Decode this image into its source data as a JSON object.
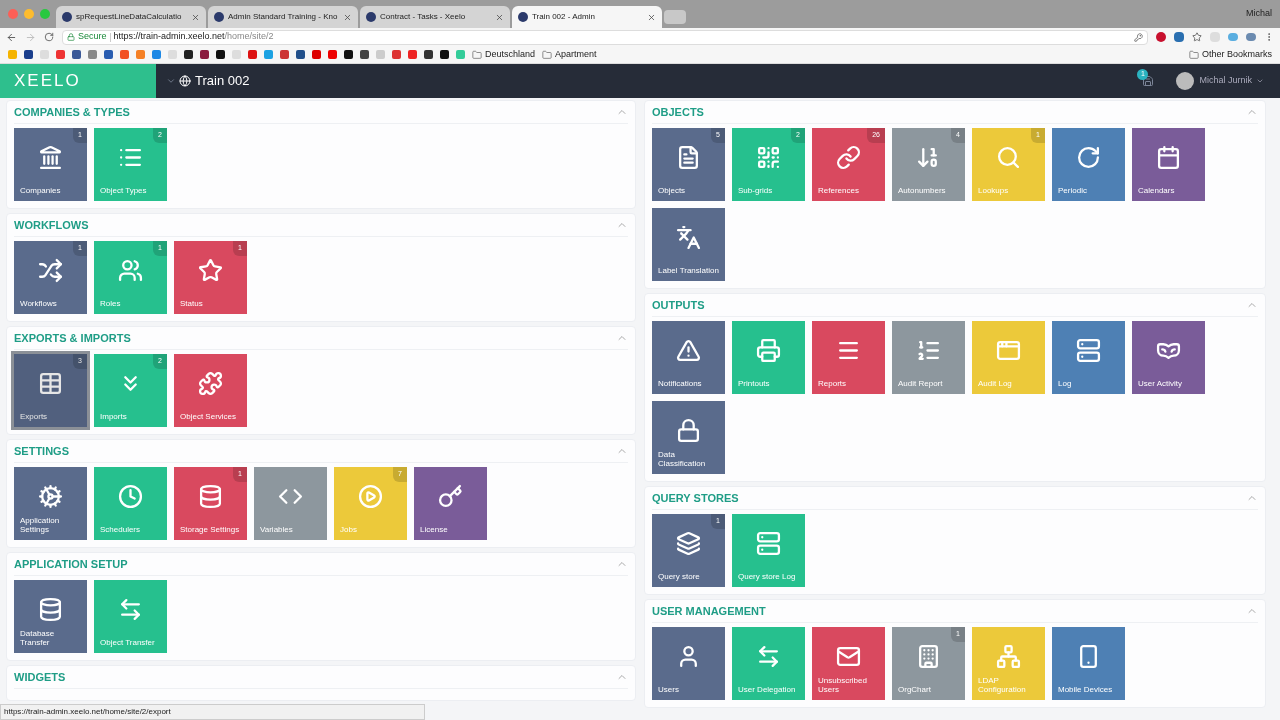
{
  "browser": {
    "tabs": [
      {
        "title": "spRequestLineDataCalculatio",
        "selected": false
      },
      {
        "title": "Admin Standard Training - Kno",
        "selected": false
      },
      {
        "title": "Contract - Tasks - Xeelo",
        "selected": false
      },
      {
        "title": "Train 002 - Admin",
        "selected": true
      }
    ],
    "profile": "Michal",
    "secure_label": "Secure",
    "url_host": "https://train-admin.xeelo.net",
    "url_path": "/home/site/2",
    "bookmark_folders": [
      "Deutschland",
      "Apartment"
    ],
    "other_bookmarks": "Other Bookmarks",
    "status_url": "https://train-admin.xeelo.net/home/site/2/export"
  },
  "header": {
    "logo": "XEELO",
    "site": "Train 002",
    "notification_count": "1",
    "user": "Michal Jurnik"
  },
  "columns": [
    [
      {
        "title": "COMPANIES & TYPES",
        "tiles": [
          {
            "label": "Companies",
            "badge": "1",
            "color": "#5a6b8c",
            "hovered": false
          },
          {
            "label": "Object Types",
            "badge": "2",
            "color": "#26c08e",
            "hovered": false
          }
        ]
      },
      {
        "title": "WORKFLOWS",
        "tiles": [
          {
            "label": "Workflows",
            "badge": "1",
            "color": "#5a6b8c",
            "hovered": false
          },
          {
            "label": "Roles",
            "badge": "1",
            "color": "#26c08e",
            "hovered": false
          },
          {
            "label": "Status",
            "badge": "1",
            "color": "#d9495f",
            "hovered": false
          }
        ]
      },
      {
        "title": "EXPORTS & IMPORTS",
        "tiles": [
          {
            "label": "Exports",
            "badge": "3",
            "color": "#5a6b8c",
            "hovered": true
          },
          {
            "label": "Imports",
            "badge": "2",
            "color": "#26c08e",
            "hovered": false
          },
          {
            "label": "Object Services",
            "color": "#d9495f",
            "hovered": false
          }
        ]
      },
      {
        "title": "SETTINGS",
        "tiles": [
          {
            "label": "Application Settings",
            "color": "#5a6b8c",
            "hovered": false
          },
          {
            "label": "Schedulers",
            "color": "#26c08e",
            "hovered": false
          },
          {
            "label": "Storage Settings",
            "badge": "1",
            "color": "#d9495f",
            "hovered": false
          },
          {
            "label": "Variables",
            "color": "#8d979e",
            "hovered": false
          },
          {
            "label": "Jobs",
            "badge": "7",
            "color": "#ecc93a",
            "hovered": false
          },
          {
            "label": "License",
            "color": "#7a5c99",
            "hovered": false
          }
        ]
      },
      {
        "title": "APPLICATION SETUP",
        "tiles": [
          {
            "label": "Database Transfer",
            "color": "#5a6b8c",
            "hovered": false
          },
          {
            "label": "Object Transfer",
            "color": "#26c08e",
            "hovered": false
          }
        ]
      },
      {
        "title": "WIDGETS"
      }
    ],
    [
      {
        "title": "OBJECTS",
        "tiles": [
          {
            "label": "Objects",
            "badge": "5",
            "color": "#5a6b8c",
            "hovered": false
          },
          {
            "label": "Sub-grids",
            "badge": "2",
            "color": "#26c08e",
            "hovered": false
          },
          {
            "label": "References",
            "badge": "26",
            "color": "#d9495f",
            "hovered": false
          },
          {
            "label": "Autonumbers",
            "badge": "4",
            "color": "#8d979e",
            "hovered": false
          },
          {
            "label": "Lookups",
            "badge": "1",
            "color": "#ecc93a",
            "hovered": false
          },
          {
            "label": "Periodic",
            "color": "#4e80b4",
            "hovered": false
          },
          {
            "label": "Calendars",
            "color": "#7a5c99",
            "hovered": false
          },
          {
            "label": "Label Translation",
            "color": "#5a6b8c",
            "hovered": false
          }
        ]
      },
      {
        "title": "OUTPUTS",
        "tiles": [
          {
            "label": "Notifications",
            "color": "#5a6b8c",
            "hovered": false
          },
          {
            "label": "Printouts",
            "color": "#26c08e",
            "hovered": false
          },
          {
            "label": "Reports",
            "color": "#d9495f",
            "hovered": false
          },
          {
            "label": "Audit Report",
            "color": "#8d979e",
            "hovered": false
          },
          {
            "label": "Audit Log",
            "color": "#ecc93a",
            "hovered": false
          },
          {
            "label": "Log",
            "color": "#4e80b4",
            "hovered": false
          },
          {
            "label": "User Activity",
            "color": "#7a5c99",
            "hovered": false
          },
          {
            "label": "Data Classification",
            "color": "#5a6b8c",
            "hovered": false
          }
        ]
      },
      {
        "title": "QUERY STORES",
        "tiles": [
          {
            "label": "Query store",
            "badge": "1",
            "color": "#5a6b8c",
            "hovered": false
          },
          {
            "label": "Query store Log",
            "color": "#26c08e",
            "hovered": false
          }
        ]
      },
      {
        "title": "USER MANAGEMENT",
        "tiles": [
          {
            "label": "Users",
            "color": "#5a6b8c",
            "hovered": false
          },
          {
            "label": "User Delegation",
            "color": "#26c08e",
            "hovered": false
          },
          {
            "label": "Unsubscribed Users",
            "color": "#d9495f",
            "hovered": false
          },
          {
            "label": "OrgChart",
            "badge": "1",
            "color": "#8d979e",
            "hovered": false
          },
          {
            "label": "LDAP Configuration",
            "color": "#ecc93a",
            "hovered": false
          },
          {
            "label": "Mobile Devices",
            "color": "#4e80b4",
            "hovered": false
          }
        ]
      }
    ]
  ]
}
